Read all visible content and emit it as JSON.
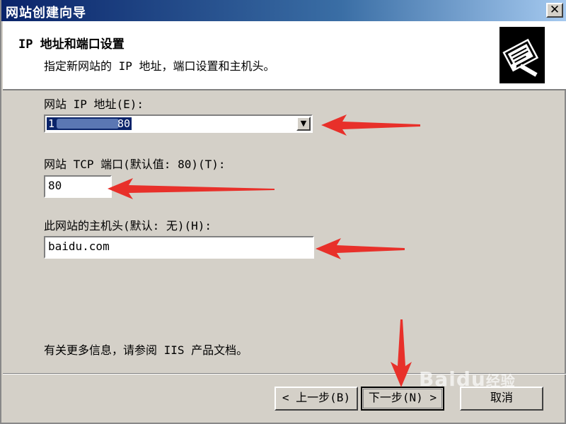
{
  "window": {
    "title": "网站创建向导",
    "close_label": "✕"
  },
  "header": {
    "title": "IP 地址和端口设置",
    "subtitle": "指定新网站的 IP 地址，端口设置和主机头。",
    "icon": "wizard-book-icon"
  },
  "fields": {
    "ip": {
      "label": "网站 IP 地址(E):",
      "value": "1…80",
      "value_visible_start": "1",
      "value_visible_end": "80"
    },
    "port": {
      "label": "网站 TCP 端口(默认值: 80)(T):",
      "value": "80"
    },
    "host": {
      "label": "此网站的主机头(默认: 无)(H):",
      "value": "baidu.com"
    }
  },
  "info_text": "有关更多信息，请参阅 IIS 产品文档。",
  "buttons": {
    "back": "< 上一步(B)",
    "next": "下一步(N) >",
    "cancel": "取消"
  },
  "annotations": {
    "arrow_color": "#e8302a"
  },
  "watermark": {
    "brand": "Baidu",
    "text": "经验"
  },
  "colors": {
    "titlebar": "#0a246a",
    "dialog_bg": "#d4d0c8",
    "selection": "#0a246a"
  }
}
